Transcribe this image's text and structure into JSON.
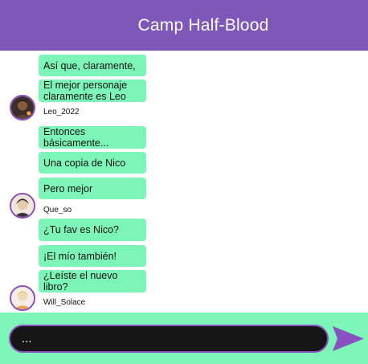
{
  "header": {
    "title": "Camp Half-Blood"
  },
  "messages": [
    {
      "text": "Así que, claramente,"
    },
    {
      "text": "El mejor personaje claramente es Leo"
    },
    {
      "text": "Entonces básicamente..."
    },
    {
      "text": "Una copia de Nico"
    },
    {
      "text": "Pero mejor"
    },
    {
      "text": "¿Tu fav es Nico?"
    },
    {
      "text": "¡El mío también!"
    },
    {
      "text": "¿Leíste el nuevo libro?"
    }
  ],
  "users": [
    {
      "name": "Leo_2022"
    },
    {
      "name": "Que_so"
    },
    {
      "name": "Will_Solace"
    }
  ],
  "composer": {
    "value": "...",
    "send_icon": "send-icon"
  },
  "colors": {
    "header": "#7e57b8",
    "bubble": "#7ef5b8",
    "footer": "#7ef5b8",
    "input_bg": "#161616",
    "accent": "#8a4fc0"
  }
}
